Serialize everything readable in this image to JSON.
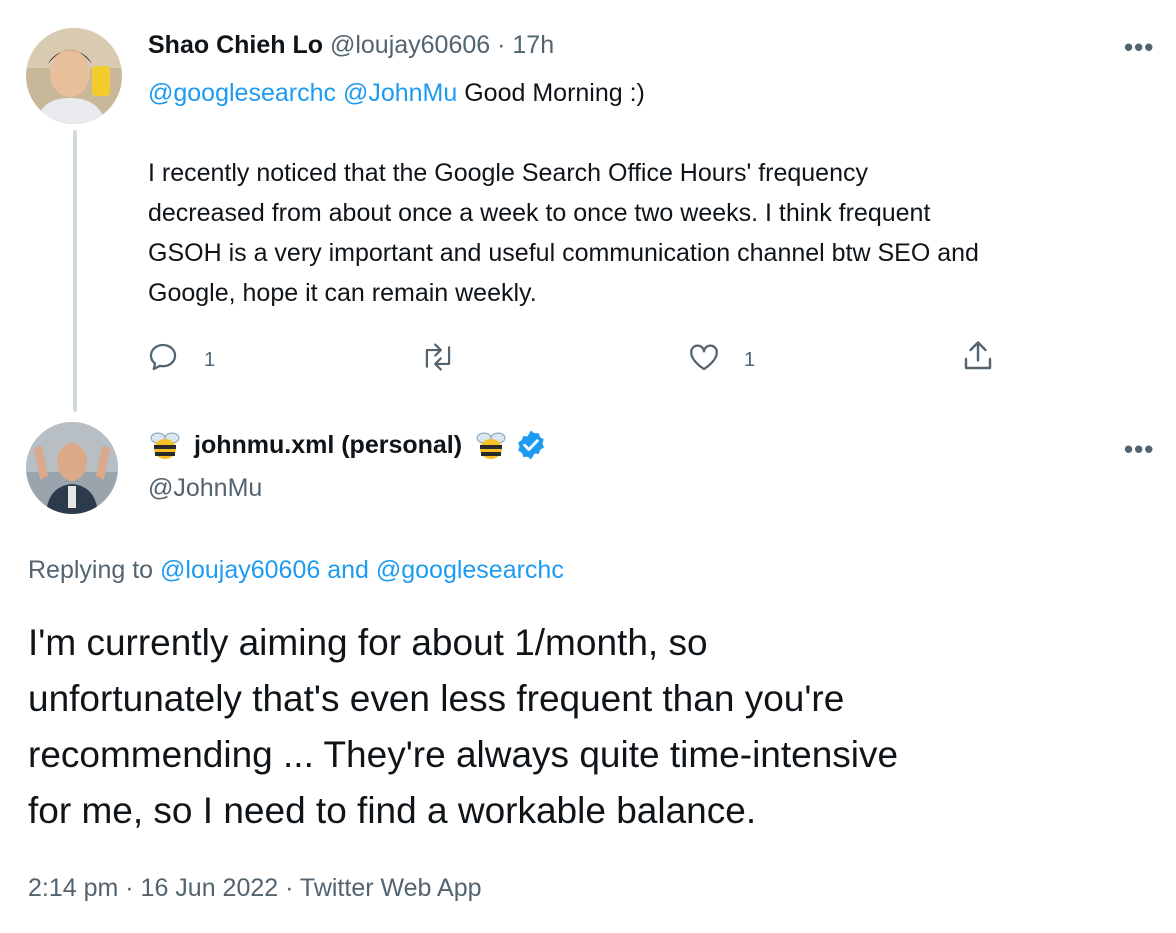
{
  "reply_tweet": {
    "display_name": "Shao Chieh Lo",
    "handle": "@loujay60606",
    "separator": "·",
    "time_ago": "17h",
    "mention1": "@googlesearchc",
    "mention2": "@JohnMu",
    "greeting": "Good Morning :)",
    "body_lines": [
      "I recently noticed that the Google Search Office Hours' frequency",
      "decreased from about once a week to once two weeks. I think frequent",
      "GSOH is a very important and useful communication channel btw SEO and",
      "Google, hope it can remain weekly."
    ],
    "reply_count": "1",
    "like_count": "1"
  },
  "main_tweet": {
    "display_name": "johnmu.xml (personal)",
    "handle": "@JohnMu",
    "replying_to_label": "Replying to",
    "replying_to_users": "@loujay60606 and @googlesearchc",
    "body_lines": [
      "I'm currently aiming for about 1/month, so",
      "unfortunately that's even less frequent than you're",
      "recommending ... They're always quite time-intensive",
      "for me, so I need to find a workable balance."
    ],
    "timestamp": "2:14 pm · 16 Jun 2022 · Twitter Web App"
  },
  "icons": {
    "more": "more-dots-icon",
    "reply": "reply-icon",
    "retweet": "retweet-icon",
    "like": "heart-icon",
    "share": "share-icon",
    "verified": "verified-badge-icon",
    "bee": "bee-emoji-icon"
  },
  "colors": {
    "link": "#1d9bf0",
    "muted": "#536471",
    "text": "#0f1419",
    "thread_line": "#cfd9de"
  }
}
